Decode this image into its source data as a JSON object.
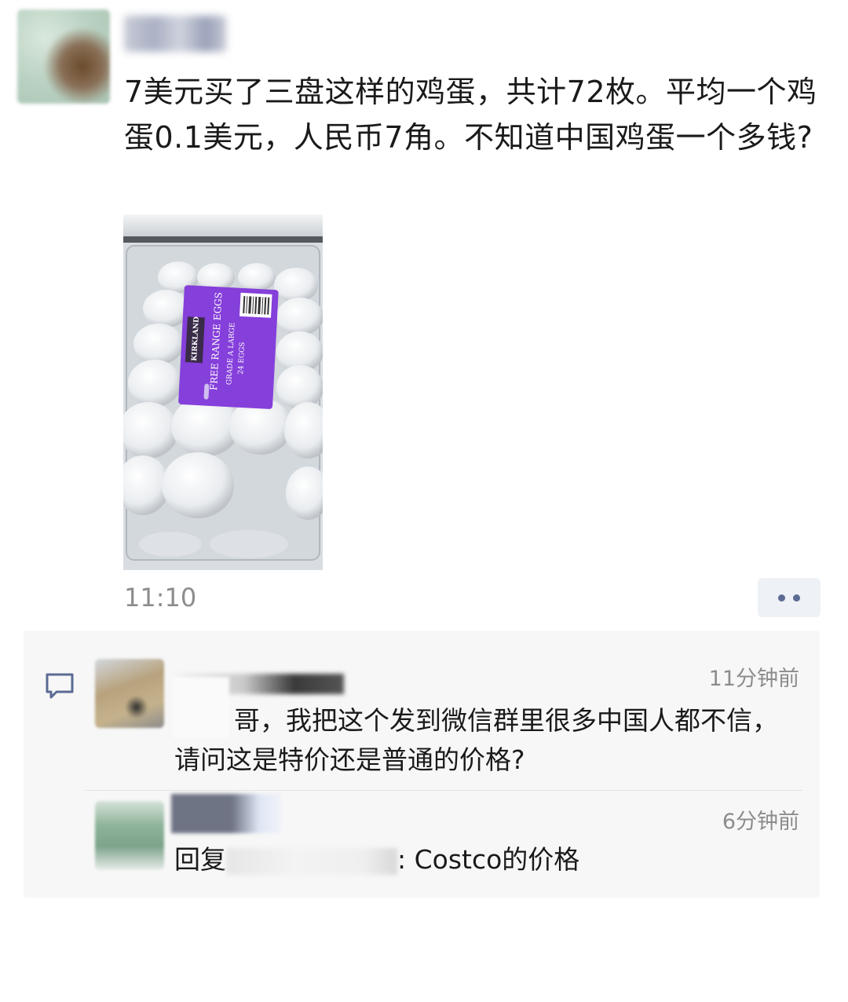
{
  "post": {
    "text": "7美元买了三盘这样的鸡蛋，共计72枚。平均一个鸡蛋0.1美元，人民币7角。不知道中国鸡蛋一个多钱?",
    "time": "11:10",
    "photo": {
      "brand": "KIRKLAND",
      "product": "FREE RANGE EGGS",
      "grade": "GRADE A LARGE",
      "count": "24 EGGS"
    }
  },
  "comments": [
    {
      "time": "11分钟前",
      "text": "哥，我把这个发到微信群里很多中国人都不信，请问这是特价还是普通的价格?"
    },
    {
      "time": "6分钟前",
      "reply_prefix": "回复",
      "reply_suffix": ": Costco的价格"
    }
  ],
  "icons": {
    "comment": "comment-icon",
    "more": "more-dots-icon"
  },
  "colors": {
    "link_dots": "#5b6b94",
    "timestamp": "#8c8c8c",
    "comment_bg": "#f7f7f7",
    "carton_label": "#7b2fd8"
  }
}
